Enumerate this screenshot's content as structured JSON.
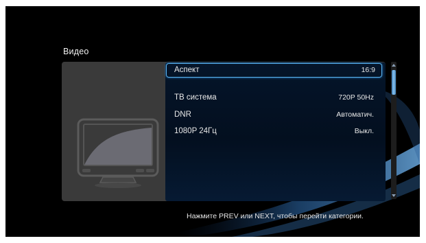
{
  "section": {
    "title": "Видео"
  },
  "settings": [
    {
      "label": "Аспект",
      "value": "16:9"
    },
    {
      "label": "ТВ система",
      "value": "720P 50Hz"
    },
    {
      "label": "DNR",
      "value": "Автоматич."
    },
    {
      "label": "1080P 24Гц",
      "value": "Выкл."
    }
  ],
  "footer": {
    "hint": "Нажмите PREV или NEXT, чтобы перейти категории."
  },
  "icons": {
    "illustration": "tv-icon",
    "scroll_up": "arrow-up-icon",
    "scroll_down": "arrow-down-icon"
  },
  "colors": {
    "accent": "#5cb6f2",
    "list_bg": "#05152a",
    "panel_bg": "#3a3a3a",
    "background": "#000000"
  }
}
